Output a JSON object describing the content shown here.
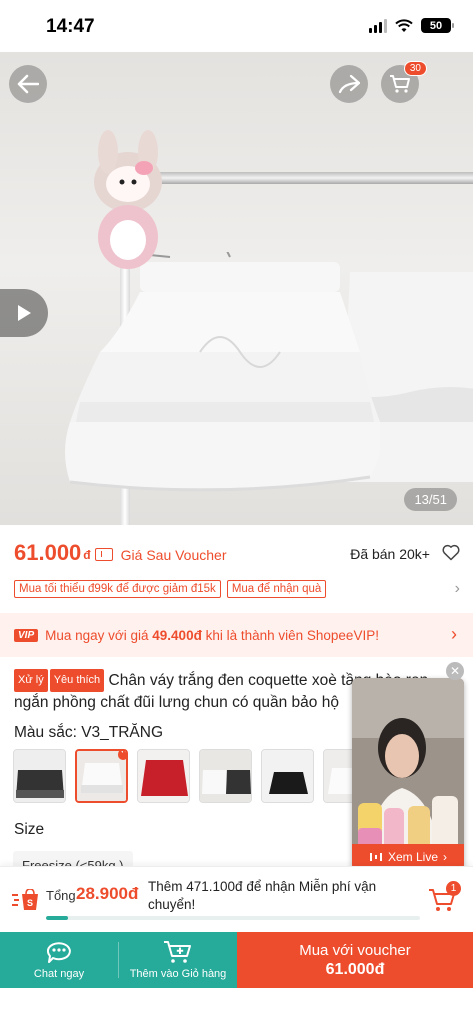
{
  "status": {
    "time": "14:47",
    "battery": "50"
  },
  "header": {
    "cart_count": "30"
  },
  "gallery": {
    "counter": "13/51"
  },
  "price": {
    "value": "61.000",
    "currency": "đ",
    "note": "Giá Sau Voucher",
    "sold": "Đã bán 20k+"
  },
  "promos": [
    "Mua tối thiểu đ99k để được giảm đ15k",
    "Mua để nhận quà"
  ],
  "vip": {
    "logo": "VIP",
    "text_before": "Mua ngay với giá ",
    "price": "49.400đ",
    "text_after": " khi là thành viên ShopeeVIP!"
  },
  "title": {
    "badge1": "Xử lý",
    "badge2": "Yêu thích",
    "text": "Chân váy trắng đen coquette xoè tầng bèo ren ngắn phồng chất đũi lưng chun có quần bảo hộ"
  },
  "variants": {
    "label": "Màu sắc: V3_TRĂNG",
    "size_label": "Size",
    "size_option": "Freesize (<59kg )"
  },
  "live": {
    "button": "Xem Live"
  },
  "shipping": {
    "total_label": "Tổng",
    "total": "28.900đ",
    "message": "Thêm 471.100đ để nhận Miễn phí vận chuyển!",
    "progress_pct": 6,
    "cart_badge": "1"
  },
  "bottom": {
    "chat": "Chat ngay",
    "add_cart": "Thêm vào Giỏ hàng",
    "buy_label": "Mua với voucher",
    "buy_price": "61.000đ"
  },
  "colors": {
    "primary": "#ee4d2d",
    "teal": "#26aa99"
  }
}
